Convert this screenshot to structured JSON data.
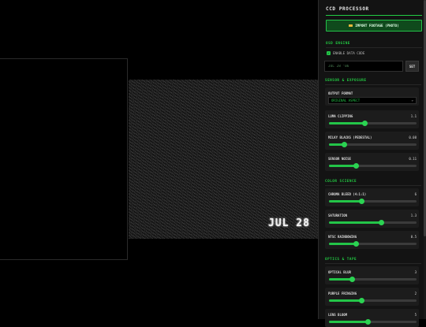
{
  "viewport": {
    "date_overlay": "JUL 28 '"
  },
  "panel": {
    "title": "CCD PROCESSOR",
    "import_button": "IMPORT FOOTAGE (PHOTO)",
    "sections": {
      "osd": "OSD ENGINE",
      "sensor": "SENSOR & EXPOSURE",
      "color": "COLOR SCIENCE",
      "optics": "OPTICS & TAPE"
    },
    "osd": {
      "enable_label": "ENABLE DATA CODE",
      "enabled": true,
      "date_input_value": "JUL 28 '06",
      "set_button": "SET"
    },
    "output_format": {
      "label": "OUTPUT FORMAT",
      "selected": "ORIGINAL ASPECT"
    },
    "controls": [
      {
        "id": "luma-clipping",
        "label": "LUMA CLIPPING",
        "value": "1.1",
        "fraction": 0.41
      },
      {
        "id": "milky-blacks",
        "label": "MILKY BLACKS (PEDESTAL)",
        "value": "0.08",
        "fraction": 0.18
      },
      {
        "id": "sensor-noise",
        "label": "SENSOR NOISE",
        "value": "0.11",
        "fraction": 0.31
      },
      {
        "id": "chroma-bleed",
        "label": "CHROMA BLEED (4:1:1)",
        "value": "6",
        "fraction": 0.37
      },
      {
        "id": "saturation",
        "label": "SATURATION",
        "value": "1.3",
        "fraction": 0.6
      },
      {
        "id": "ntsc-rainbowing",
        "label": "NTSC RAINBOWING",
        "value": "0.5",
        "fraction": 0.31
      },
      {
        "id": "optical-blur",
        "label": "OPTICAL BLUR",
        "value": "3",
        "fraction": 0.27
      },
      {
        "id": "purple-fringing",
        "label": "PURPLE FRINGING",
        "value": "2",
        "fraction": 0.37
      },
      {
        "id": "lens-bloom",
        "label": "LENS BLOOM",
        "value": "5",
        "fraction": 0.45
      }
    ],
    "icons": {
      "import": "folder-icon",
      "checkbox": "check-icon",
      "select": "chevron-down-icon"
    },
    "colors": {
      "accent": "#23c548",
      "button_bg": "#0f4a1c",
      "panel_bg": "#131313"
    }
  }
}
